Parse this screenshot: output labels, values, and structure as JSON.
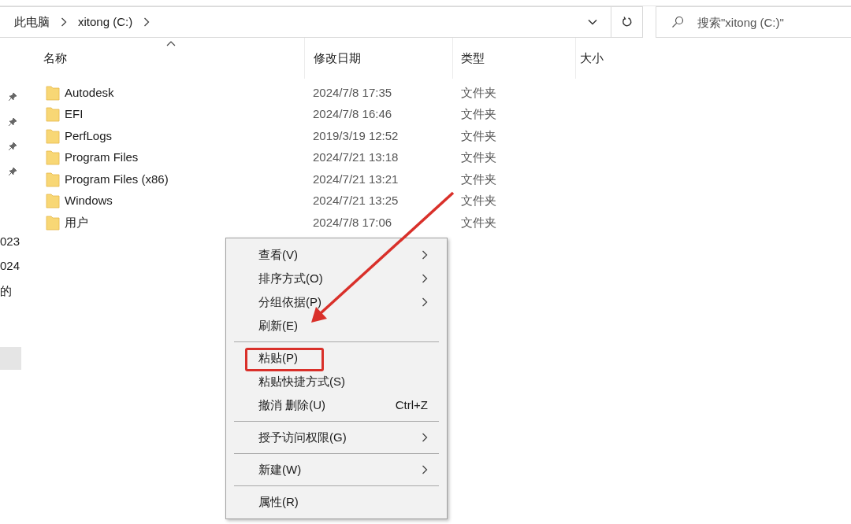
{
  "address_bar": {
    "path": [
      "此电脑",
      "xitong (C:)"
    ]
  },
  "search": {
    "placeholder": "搜索\"xitong (C:)\""
  },
  "nav_pane": {
    "items": [
      {
        "kind": "pinned"
      },
      {
        "kind": "pinned"
      },
      {
        "kind": "pinned"
      },
      {
        "kind": "pinned"
      },
      {
        "kind": "text",
        "label": "023"
      },
      {
        "kind": "text",
        "label": "024"
      },
      {
        "kind": "text",
        "label": "的"
      },
      {
        "kind": "selected"
      }
    ]
  },
  "columns": [
    "名称",
    "修改日期",
    "类型",
    "大小"
  ],
  "rows": [
    {
      "name": "Autodesk",
      "modified": "2024/7/8 17:35",
      "type": "文件夹"
    },
    {
      "name": "EFI",
      "modified": "2024/7/8 16:46",
      "type": "文件夹"
    },
    {
      "name": "PerfLogs",
      "modified": "2019/3/19 12:52",
      "type": "文件夹"
    },
    {
      "name": "Program Files",
      "modified": "2024/7/21 13:18",
      "type": "文件夹"
    },
    {
      "name": "Program Files (x86)",
      "modified": "2024/7/21 13:21",
      "type": "文件夹"
    },
    {
      "name": "Windows",
      "modified": "2024/7/21 13:25",
      "type": "文件夹"
    },
    {
      "name": "用户",
      "modified": "2024/7/8 17:06",
      "type": "文件夹"
    }
  ],
  "context_menu": {
    "groups": [
      [
        {
          "label": "查看(V)",
          "submenu": true,
          "highlighted": false
        },
        {
          "label": "排序方式(O)",
          "submenu": true,
          "highlighted": false
        },
        {
          "label": "分组依据(P)",
          "submenu": true,
          "highlighted": false
        },
        {
          "label": "刷新(E)",
          "submenu": false,
          "highlighted": false
        }
      ],
      [
        {
          "label": "粘贴(P)",
          "submenu": false,
          "highlighted": true
        },
        {
          "label": "粘贴快捷方式(S)",
          "submenu": false,
          "highlighted": false
        },
        {
          "label": "撤消 删除(U)",
          "shortcut": "Ctrl+Z",
          "submenu": false,
          "highlighted": false
        }
      ],
      [
        {
          "label": "授予访问权限(G)",
          "submenu": true,
          "highlighted": false
        }
      ],
      [
        {
          "label": "新建(W)",
          "submenu": true,
          "highlighted": false
        }
      ],
      [
        {
          "label": "属性(R)",
          "submenu": false,
          "highlighted": false
        }
      ]
    ]
  }
}
